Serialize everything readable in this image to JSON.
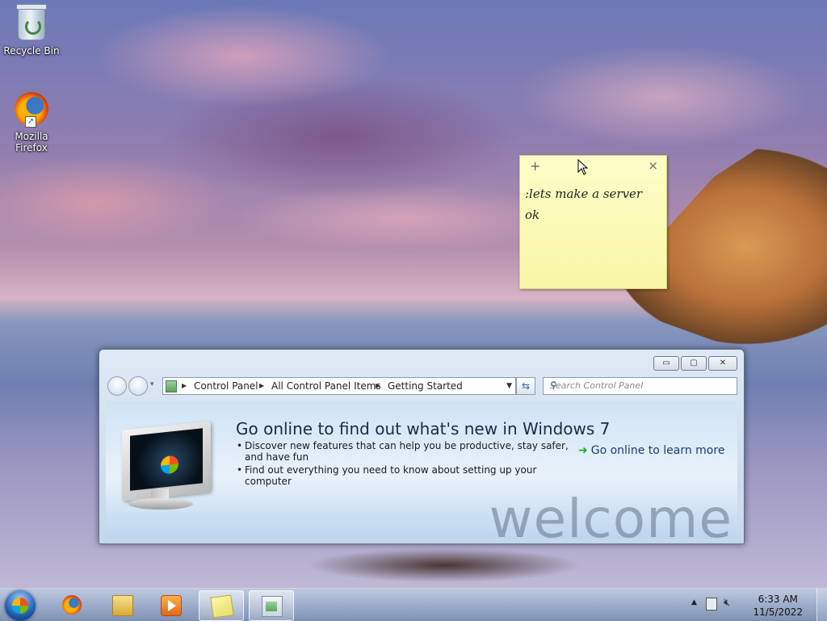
{
  "desktop": {
    "icons": [
      {
        "label": "Recycle Bin"
      },
      {
        "label": "Mozilla Firefox"
      }
    ]
  },
  "sticky_note": {
    "add": "+",
    "close": "×",
    "text": ":lets make a server\nok"
  },
  "window": {
    "controls": {
      "minimize": "▭",
      "maximize": "▢",
      "close": "✕"
    },
    "breadcrumb": [
      "Control Panel",
      "All Control Panel Items",
      "Getting Started"
    ],
    "search_placeholder": "Search Control Panel",
    "headline": "Go online to find out what's new in Windows 7",
    "bullets": [
      "Discover new features that can help you be productive, stay safer, and have fun",
      "Find out everything you need to know about setting up your computer"
    ],
    "link": "Go online to learn more",
    "watermark": "welcome"
  },
  "taskbar": {
    "time": "6:33 AM",
    "date": "11/5/2022"
  },
  "colors": {
    "sticky": "#f8f6a6",
    "link": "#1a3d6e",
    "accent_green": "#2aa62a"
  }
}
